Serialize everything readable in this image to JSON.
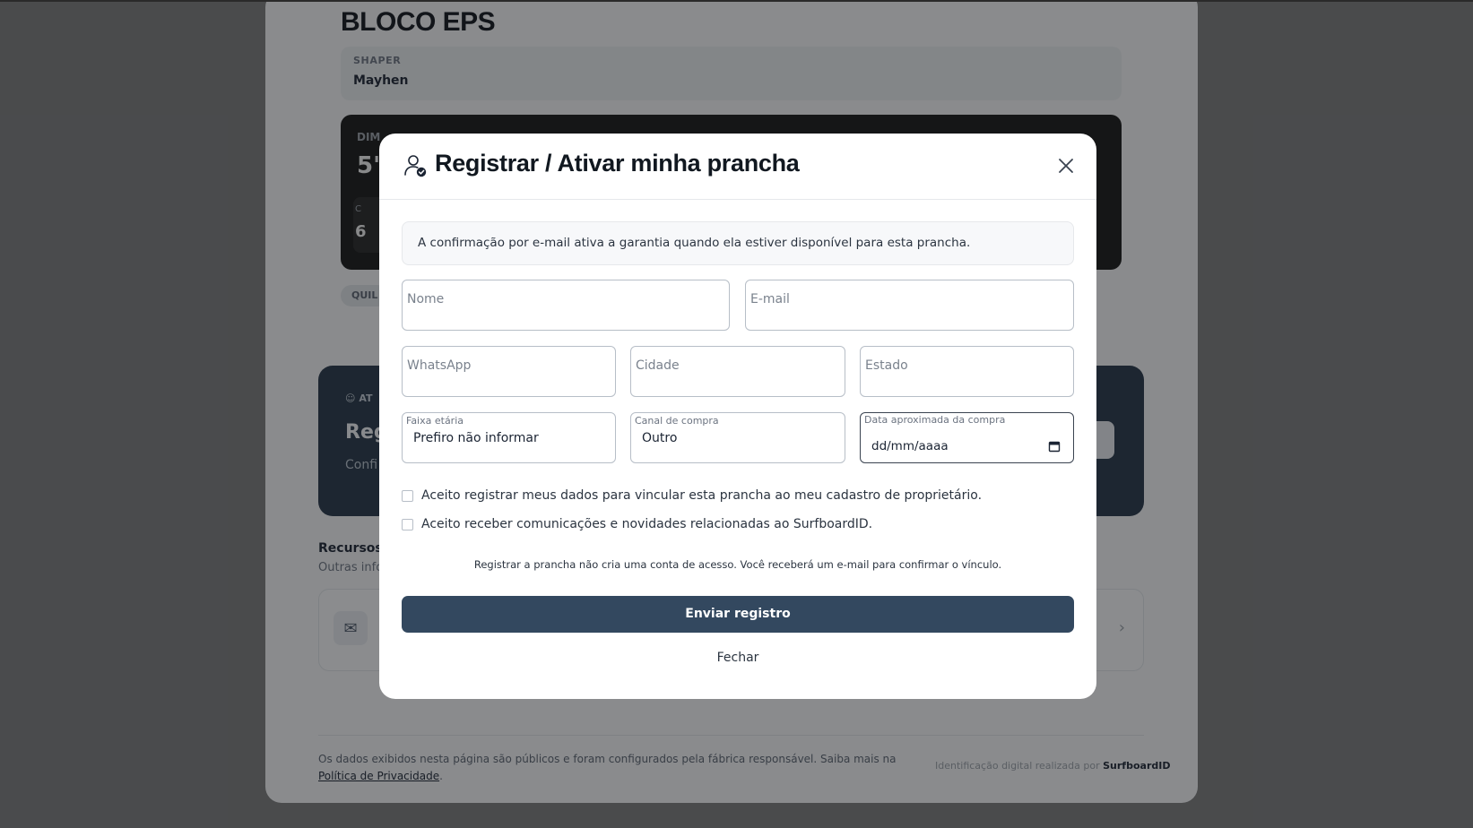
{
  "background": {
    "board_title": "BLOCO EPS",
    "shaper_label": "SHAPER",
    "shaper_value": "Mayhen",
    "dimensions_label": "DIM",
    "dimensions_value": "5'4",
    "sub_label": "C",
    "sub_value": "6",
    "fins_label": "QUIL",
    "owner_tag": "AT",
    "owner_title": "Reg",
    "owner_desc": "Confi pranc",
    "resources_title": "Recursos",
    "resources_subtitle": "Outras info",
    "footer_text": "Os dados exibidos nesta página são públicos e foram configurados pela fábrica responsável. Saiba mais na ",
    "footer_link": "Política de Privacidade",
    "footer_period": ".",
    "footer_right_text": "Identificação digital realizada por ",
    "footer_right_brand": "SurfboardID"
  },
  "modal": {
    "title": "Registrar / Ativar minha prancha",
    "info": "A confirmação por e-mail ativa a garantia quando ela estiver disponível para esta prancha.",
    "fields": {
      "nome": "Nome",
      "email": "E-mail",
      "whatsapp": "WhatsApp",
      "cidade": "Cidade",
      "estado": "Estado",
      "faixa_label": "Faixa etária",
      "faixa_value": "Prefiro não informar",
      "canal_label": "Canal de compra",
      "canal_value": "Outro",
      "data_label": "Data aproximada da compra",
      "data_value": "dd/mm/aaaa"
    },
    "consent1": "Aceito registrar meus dados para vincular esta prancha ao meu cadastro de proprietário.",
    "consent2": "Aceito receber comunicações e novidades relacionadas ao SurfboardID.",
    "note": "Registrar a prancha não cria uma conta de acesso. Você receberá um e-mail para confirmar o vínculo.",
    "submit": "Enviar registro",
    "close": "Fechar"
  },
  "icons": {
    "user_check": "user-check-icon",
    "close": "close-icon",
    "calendar": "calendar-icon",
    "mail": "mail-icon",
    "chevron": "chevron-right-icon"
  }
}
